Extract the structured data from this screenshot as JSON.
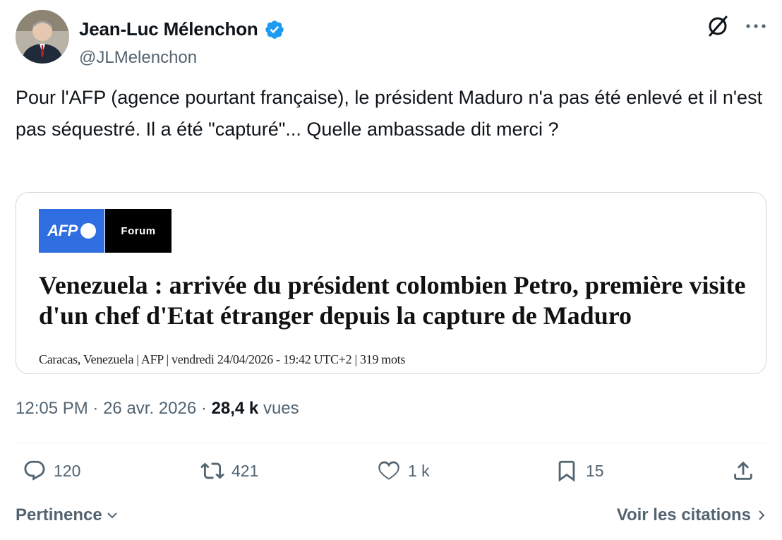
{
  "author": {
    "name": "Jean-Luc Mélenchon",
    "handle": "@JLMelenchon",
    "verified_color": "#1d9bf0"
  },
  "tweet": {
    "text": "Pour l'AFP (agence pourtant française), le président Maduro n'a pas été enlevé et il n'est pas séquestré. Il a été \"capturé\"... Quelle ambassade dit merci ?"
  },
  "card": {
    "logo_left": "AFP",
    "logo_right": "Forum",
    "title": "Venezuela : arrivée du président colombien Petro, première visite d'un chef d'Etat étranger depuis la capture de Maduro",
    "meta": "Caracas, Venezuela | AFP | vendredi 24/04/2026 - 19:42 UTC+2 | 319 mots"
  },
  "meta": {
    "time": "12:05 PM",
    "sep1": "·",
    "date": "26 avr. 2026",
    "sep2": "·",
    "views_count": "28,4 k",
    "views_label": "vues"
  },
  "actions": {
    "replies": "120",
    "reposts": "421",
    "likes": "1 k",
    "bookmarks": "15"
  },
  "footer": {
    "sort_label": "Pertinence",
    "quotes_label": "Voir les citations"
  },
  "icons": {
    "grok": "grok-icon",
    "more": "more-icon",
    "reply": "reply-icon",
    "repost": "repost-icon",
    "like": "heart-icon",
    "bookmark": "bookmark-icon",
    "share": "share-icon",
    "sort": "chevron-down-icon",
    "quotes": "chevron-right-icon"
  },
  "colors": {
    "text_primary": "#0f1419",
    "text_secondary": "#536471",
    "afp_blue": "#2e6ee0",
    "border": "#cfd9de"
  }
}
